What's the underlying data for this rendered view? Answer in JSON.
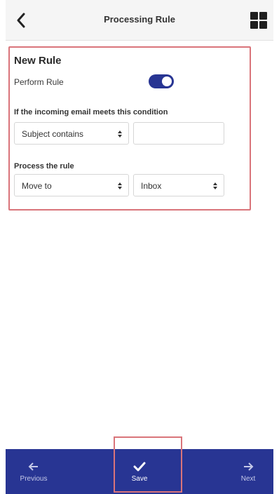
{
  "header": {
    "title": "Processing Rule",
    "back_icon": "chevron-left-icon",
    "menu_icon": "grid-icon"
  },
  "rule": {
    "title": "New Rule",
    "perform_label": "Perform Rule",
    "perform_enabled": true,
    "condition_label": "If the incoming email meets this condition",
    "condition_select": "Subject contains",
    "condition_value": "",
    "process_label": "Process the rule",
    "action_select": "Move to",
    "folder_select": "Inbox"
  },
  "footer": {
    "previous_label": "Previous",
    "save_label": "Save",
    "next_label": "Next"
  },
  "colors": {
    "accent": "#283593",
    "highlight": "#d9747a"
  }
}
